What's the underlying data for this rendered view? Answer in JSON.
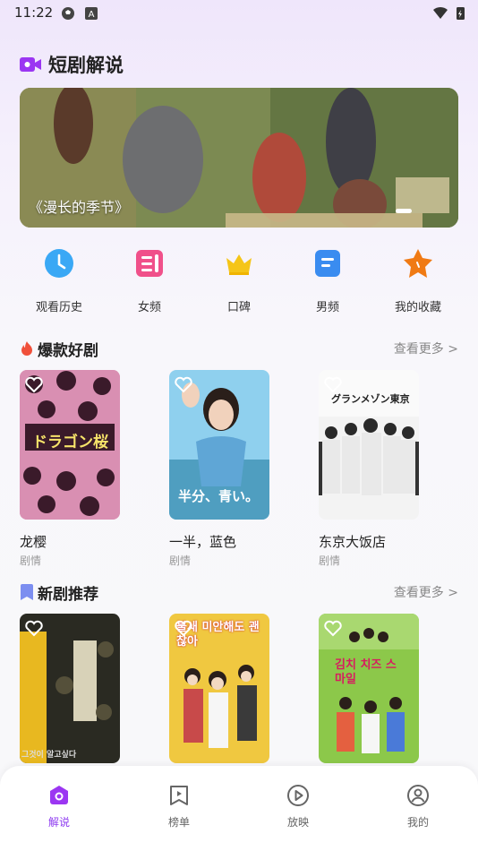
{
  "status": {
    "time": "11:22"
  },
  "app": {
    "title": "短剧解说"
  },
  "banner": {
    "caption": "《漫长的季节》"
  },
  "quick_nav": [
    {
      "label": "观看历史",
      "icon": "clock-icon"
    },
    {
      "label": "女频",
      "icon": "book-icon"
    },
    {
      "label": "口碑",
      "icon": "crown-icon"
    },
    {
      "label": "男频",
      "icon": "document-icon"
    },
    {
      "label": "我的收藏",
      "icon": "star-icon"
    }
  ],
  "hot": {
    "title": "爆款好剧",
    "more": "查看更多 >",
    "items": [
      {
        "title": "龙樱",
        "tag": "剧情",
        "poster_text": "ドラゴン桜"
      },
      {
        "title": "一半，蓝色",
        "tag": "剧情",
        "poster_text": "半分、青い。"
      },
      {
        "title": "东京大饭店",
        "tag": "剧情",
        "poster_text": "グランメゾン東京"
      }
    ]
  },
  "new": {
    "title": "新剧推荐",
    "more": "查看更多 >",
    "items": [
      {
        "poster_text": "그것이 알고싶다"
      },
      {
        "poster_text": "불새 미안해도 괜찮아"
      },
      {
        "poster_text": "김치 치즈 스마일"
      }
    ]
  },
  "tabs": [
    {
      "label": "解说",
      "icon": "home-icon",
      "active": true
    },
    {
      "label": "榜单",
      "icon": "bookmark-play-icon",
      "active": false
    },
    {
      "label": "放映",
      "icon": "play-circle-icon",
      "active": false
    },
    {
      "label": "我的",
      "icon": "user-icon",
      "active": false
    }
  ],
  "colors": {
    "accent": "#8e3bf0",
    "clock": "#3aa8f5",
    "book": "#f0508a",
    "crown": "#f5c518",
    "document": "#3a8cf0",
    "star": "#f07a14"
  }
}
